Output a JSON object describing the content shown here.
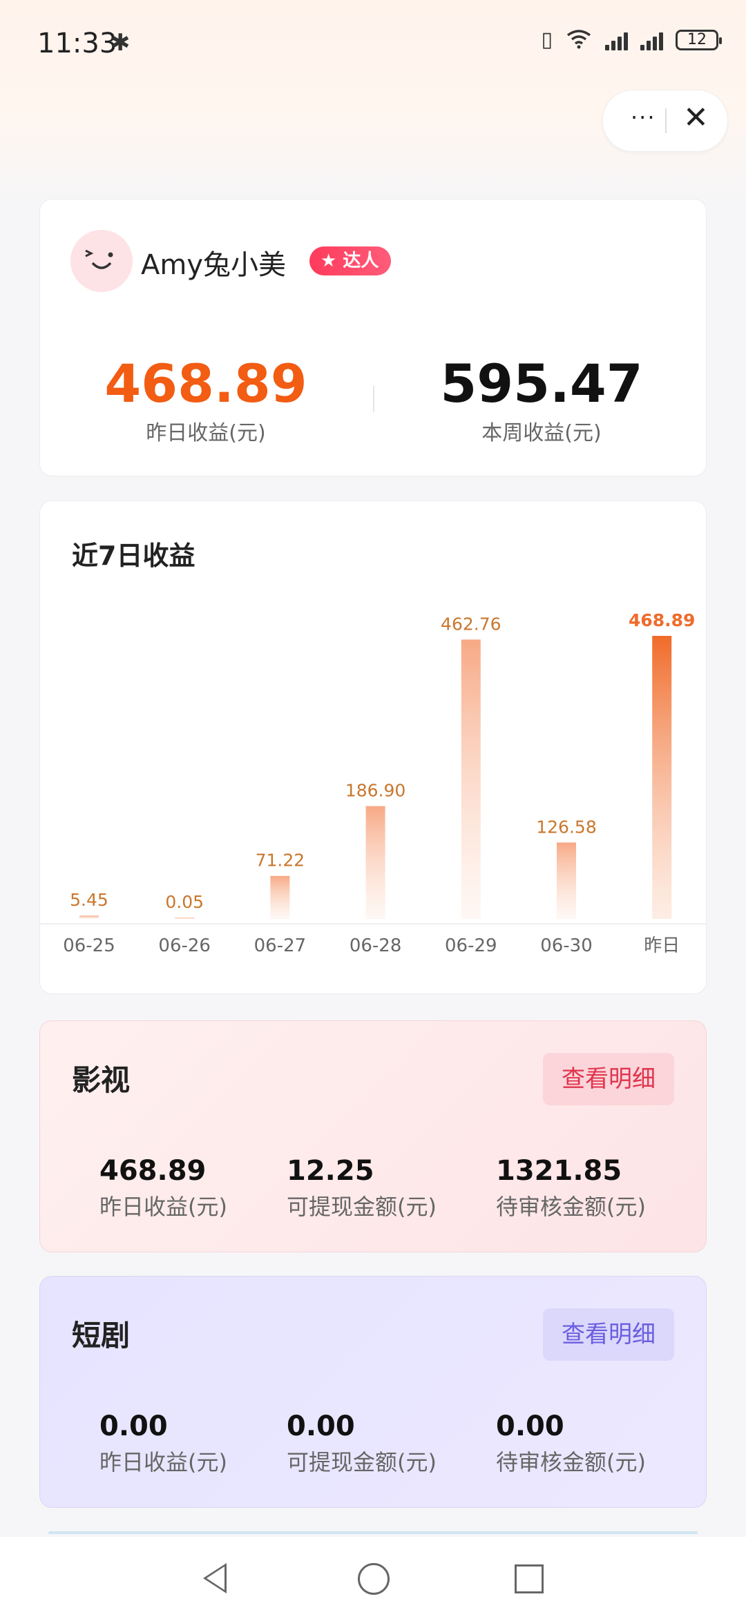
{
  "status_bar": {
    "time": "11:33",
    "battery": "12"
  },
  "capsule": {
    "more": "···",
    "close": "✕"
  },
  "profile": {
    "name": "Amy兔小美",
    "badge": "达人",
    "yesterday_value": "468.89",
    "yesterday_label": "昨日收益(元)",
    "week_value": "595.47",
    "week_label": "本周收益(元)"
  },
  "chart": {
    "title": "近7日收益"
  },
  "chart_data": {
    "type": "bar",
    "title": "近7日收益",
    "categories": [
      "06-25",
      "06-26",
      "06-27",
      "06-28",
      "06-29",
      "06-30",
      "昨日"
    ],
    "values": [
      5.45,
      0.05,
      71.22,
      186.9,
      462.76,
      126.58,
      468.89
    ],
    "value_labels": [
      "5.45",
      "0.05",
      "71.22",
      "186.90",
      "462.76",
      "126.58",
      "468.89"
    ],
    "ylim": [
      0,
      468.89
    ],
    "grid": false,
    "colors": {
      "bar": "#f8b795",
      "highlight": "#f06b2a",
      "label": "#c9772e"
    }
  },
  "sections": [
    {
      "title": "影视",
      "button": "查看明细",
      "metrics": [
        {
          "value": "468.89",
          "label": "昨日收益(元)"
        },
        {
          "value": "12.25",
          "label": "可提现金额(元)"
        },
        {
          "value": "1321.85",
          "label": "待审核金额(元)"
        }
      ]
    },
    {
      "title": "短剧",
      "button": "查看明细",
      "metrics": [
        {
          "value": "0.00",
          "label": "昨日收益(元)"
        },
        {
          "value": "0.00",
          "label": "可提现金额(元)"
        },
        {
          "value": "0.00",
          "label": "待审核金额(元)"
        }
      ]
    }
  ]
}
